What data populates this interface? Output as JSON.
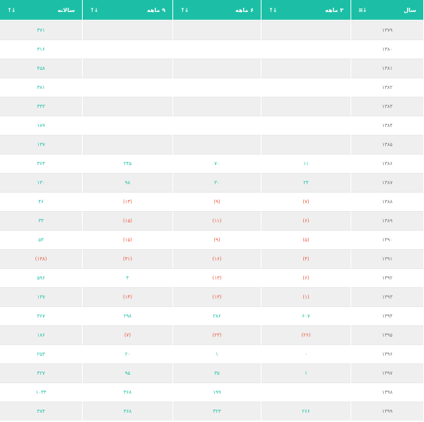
{
  "table": {
    "headers": {
      "year": "سال",
      "q3": "۳ ماهه",
      "q6": "۶ ماهه",
      "q9": "۹ ماهه",
      "annual": "سالانه"
    },
    "sort_icons": {
      "year": "sort-amount-icon",
      "others": "sort-arrows-icon"
    },
    "colors": {
      "header_bg": "#1cbfa5",
      "positive": "#1cbfa5",
      "negative": "#e8553a",
      "row_alt": "#efefef"
    },
    "rows": [
      {
        "year": "۱۳۷۹",
        "q3": "",
        "q6": "",
        "q9": "",
        "annual": "۳۷۱",
        "neg": []
      },
      {
        "year": "۱۳۸۰",
        "q3": "",
        "q6": "",
        "q9": "",
        "annual": "۳۱۶",
        "neg": []
      },
      {
        "year": "۱۳۸۱",
        "q3": "",
        "q6": "",
        "q9": "",
        "annual": "۴۵۸",
        "neg": []
      },
      {
        "year": "۱۳۸۲",
        "q3": "",
        "q6": "",
        "q9": "",
        "annual": "۳۸۱",
        "neg": []
      },
      {
        "year": "۱۳۸۳",
        "q3": "",
        "q6": "",
        "q9": "",
        "annual": "۳۴۳",
        "neg": []
      },
      {
        "year": "۱۳۸۴",
        "q3": "",
        "q6": "",
        "q9": "",
        "annual": "۱۸۹",
        "neg": []
      },
      {
        "year": "۱۳۸۵",
        "q3": "",
        "q6": "",
        "q9": "",
        "annual": "۱۳۷",
        "neg": []
      },
      {
        "year": "۱۳۸۶",
        "q3": "۱۱",
        "q6": "۷۰",
        "q9": "۲۴۵",
        "annual": "۳۶۳",
        "neg": []
      },
      {
        "year": "۱۳۸۷",
        "q3": "۲۴",
        "q6": "۳۰",
        "q9": "۹۸",
        "annual": "۱۳۰",
        "neg": []
      },
      {
        "year": "۱۳۸۸",
        "q3": "(۷)",
        "q6": "(۹)",
        "q9": "(۱۳)",
        "annual": "۴۶",
        "neg": [
          "q3",
          "q6",
          "q9"
        ]
      },
      {
        "year": "۱۳۸۹",
        "q3": "(۶)",
        "q6": "(۱۱)",
        "q9": "(۱۵)",
        "annual": "۳۳",
        "neg": [
          "q3",
          "q6",
          "q9"
        ]
      },
      {
        "year": "۱۳۹۰",
        "q3": "(۵)",
        "q6": "(۹)",
        "q9": "(۱۵)",
        "annual": "۵۳",
        "neg": [
          "q3",
          "q6",
          "q9"
        ]
      },
      {
        "year": "۱۳۹۱",
        "q3": "(۴)",
        "q6": "(۱۶)",
        "q9": "(۳۱)",
        "annual": "(۱۳۸)",
        "neg": [
          "q3",
          "q6",
          "q9",
          "annual"
        ]
      },
      {
        "year": "۱۳۹۲",
        "q3": "(۶)",
        "q6": "(۱۳)",
        "q9": "۴",
        "annual": "۵۹۶",
        "neg": [
          "q3",
          "q6"
        ]
      },
      {
        "year": "۱۳۹۳",
        "q3": "(۱)",
        "q6": "(۱۳)",
        "q9": "(۱۴)",
        "annual": "۱۳۷",
        "neg": [
          "q3",
          "q6",
          "q9"
        ]
      },
      {
        "year": "۱۳۹۴",
        "q3": "۶۰۷",
        "q6": "۲۸۶",
        "q9": "۲۹۸",
        "annual": "۳۶۷",
        "neg": []
      },
      {
        "year": "۱۳۹۵",
        "q3": "(۲۶)",
        "q6": "(۲۳)",
        "q9": "(۷)",
        "annual": "۱۸۶",
        "neg": [
          "q3",
          "q6",
          "q9"
        ]
      },
      {
        "year": "۱۳۹۶",
        "q3": "۰",
        "q6": "۱",
        "q9": "۲۰",
        "annual": "۲۵۳",
        "neg": []
      },
      {
        "year": "۱۳۹۷",
        "q3": "۱",
        "q6": "۳۵",
        "q9": "۹۵",
        "annual": "۴۲۷",
        "neg": []
      },
      {
        "year": "۱۳۹۸",
        "q3": "",
        "q6": "۱۹۹",
        "q9": "۳۶۸",
        "annual": "۱۰۳۳",
        "neg": []
      },
      {
        "year": "۱۳۹۹",
        "q3": "۲۶۶",
        "q6": "۳۲۳",
        "q9": "۳۶۸",
        "annual": "۳۸۴",
        "neg": []
      }
    ]
  }
}
